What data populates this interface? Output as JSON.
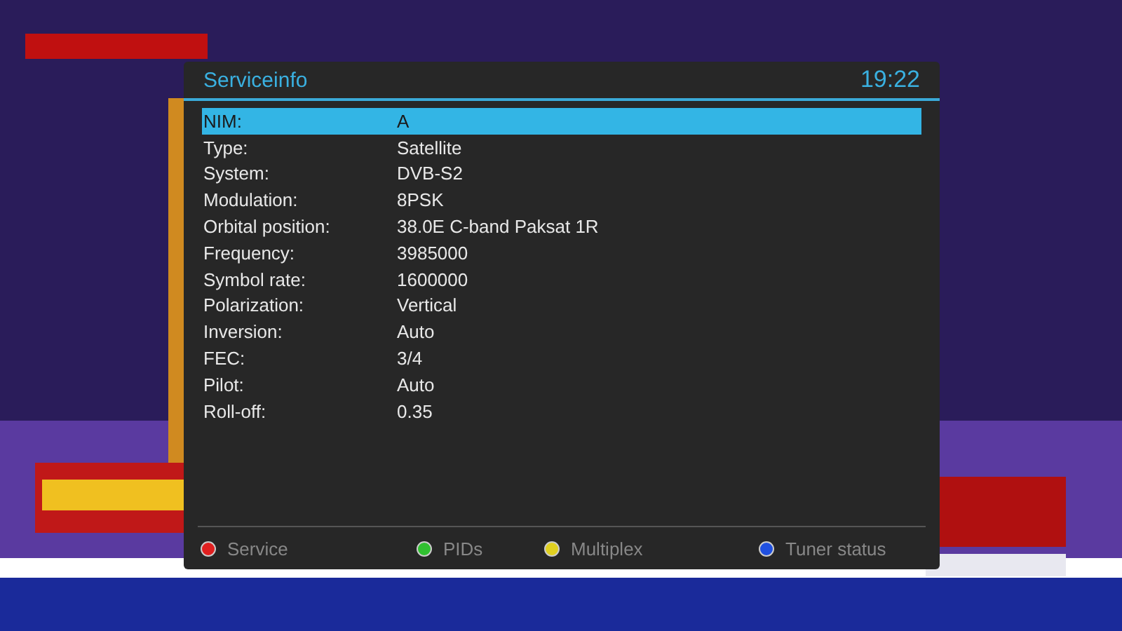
{
  "window": {
    "title": "Serviceinfo",
    "clock": "19:22"
  },
  "rows": [
    {
      "label": "NIM:",
      "value": "A",
      "selected": true
    },
    {
      "label": "Type:",
      "value": "Satellite",
      "selected": false
    },
    {
      "label": "System:",
      "value": "DVB-S2",
      "selected": false
    },
    {
      "label": "Modulation:",
      "value": "8PSK",
      "selected": false
    },
    {
      "label": "Orbital position:",
      "value": "38.0E C-band Paksat 1R",
      "selected": false
    },
    {
      "label": "Frequency:",
      "value": "3985000",
      "selected": false
    },
    {
      "label": "Symbol rate:",
      "value": "1600000",
      "selected": false
    },
    {
      "label": "Polarization:",
      "value": "Vertical",
      "selected": false
    },
    {
      "label": "Inversion:",
      "value": "Auto",
      "selected": false
    },
    {
      "label": "FEC:",
      "value": "3/4",
      "selected": false
    },
    {
      "label": "Pilot:",
      "value": "Auto",
      "selected": false
    },
    {
      "label": "Roll-off:",
      "value": "0.35",
      "selected": false
    }
  ],
  "color_keys": [
    {
      "label": "Service",
      "color": "#e02020"
    },
    {
      "label": "PIDs",
      "color": "#30c030"
    },
    {
      "label": "Multiplex",
      "color": "#e0d020"
    },
    {
      "label": "Tuner status",
      "color": "#2050e0"
    }
  ]
}
